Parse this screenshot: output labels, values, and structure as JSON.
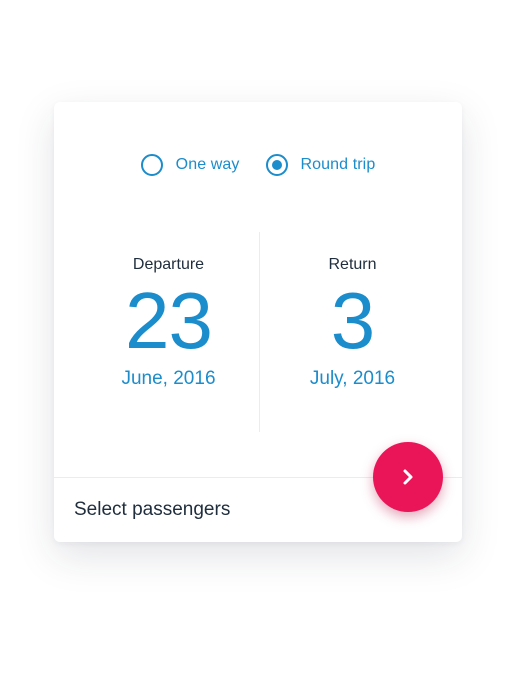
{
  "trip_type": {
    "options": [
      {
        "label": "One way",
        "selected": false
      },
      {
        "label": "Round trip",
        "selected": true
      }
    ]
  },
  "departure": {
    "caption": "Departure",
    "day": "23",
    "month_year": "June, 2016"
  },
  "return": {
    "caption": "Return",
    "day": "3",
    "month_year": "July, 2016"
  },
  "passengers": {
    "label": "Select passengers"
  },
  "next_button": {
    "icon": "chevron-right-icon"
  },
  "colors": {
    "accent": "#1b8ccc",
    "fab": "#ea1459",
    "text_dark": "#1f2d3d",
    "divider": "#ececec"
  }
}
